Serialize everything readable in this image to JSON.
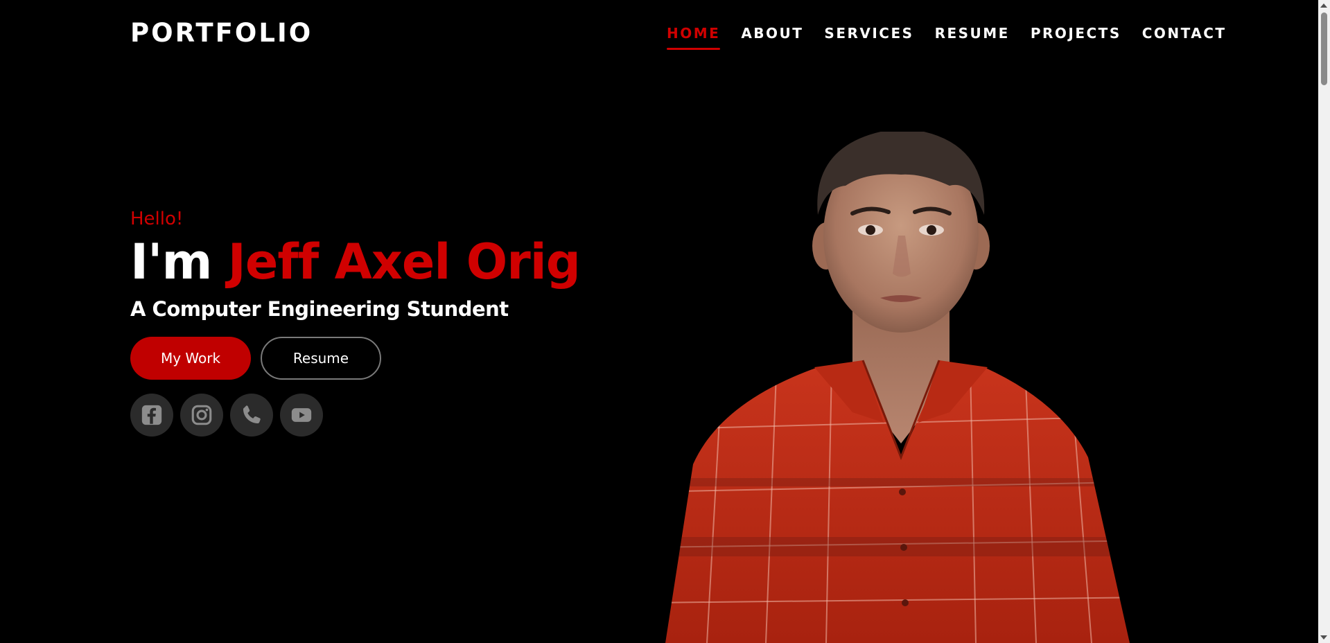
{
  "header": {
    "brand": "PORTFOLIO",
    "nav": [
      {
        "label": "HOME",
        "active": true
      },
      {
        "label": "ABOUT",
        "active": false
      },
      {
        "label": "SERVICES",
        "active": false
      },
      {
        "label": "RESUME",
        "active": false
      },
      {
        "label": "PROJECTS",
        "active": false
      },
      {
        "label": "CONTACT",
        "active": false
      }
    ]
  },
  "hero": {
    "greeting": "Hello!",
    "intro": "I'm",
    "name": "Jeff Axel Orig",
    "subtitle": "A Computer Engineering Stundent",
    "primary_button": "My Work",
    "secondary_button": "Resume",
    "socials": [
      {
        "icon": "facebook-icon"
      },
      {
        "icon": "instagram-icon"
      },
      {
        "icon": "phone-icon"
      },
      {
        "icon": "youtube-icon"
      }
    ]
  },
  "colors": {
    "background": "#000000",
    "accent": "#d00000",
    "button_primary": "#c00000",
    "social_bg": "#2b2b2b",
    "icon": "#8c8c8c"
  }
}
